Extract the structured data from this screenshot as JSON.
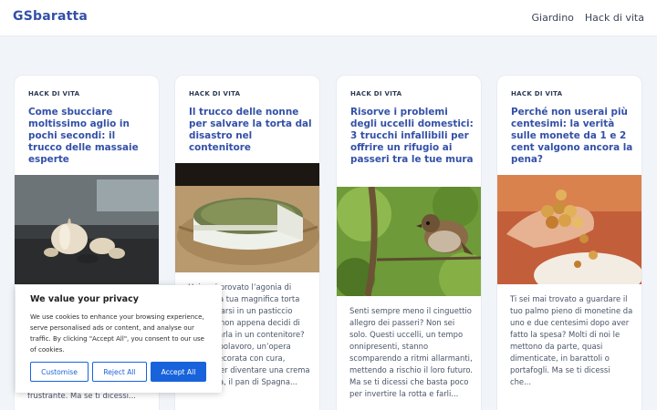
{
  "site": {
    "logo": "GSbaratta"
  },
  "nav": {
    "items": [
      "Giardino",
      "Hack di vita"
    ]
  },
  "cards": [
    {
      "category": "HACK DI VITA",
      "title": "Come sbucciare moltissimo aglio in pochi secondi: il trucco delle massaie esperte",
      "image": "garlic-photo",
      "excerpt": "frustrante. Ma se ti dicessi..."
    },
    {
      "category": "HACK DI VITA",
      "title": "Il trucco delle nonne per salvare la torta dal disastro nel contenitore",
      "image": "cake-photo",
      "excerpt": "Hai mai provato l’agonia di vedere la tua magnifica torta trasformarsi in un pasticcio informe non appena decidi di conservarla in un contenitore? Il tuo capolavoro, un’opera d’arte decorata con cura, finisce per diventare una crema spatolata, il pan di Spagna..."
    },
    {
      "category": "HACK DI VITA",
      "title": "Risorve i problemi degli uccelli domestici: 3 trucchi infallibili per offrire un rifugio ai passeri tra le tue mura",
      "image": "sparrow-photo",
      "excerpt": "Senti sempre meno il cinguettio allegro dei passeri? Non sei solo. Questi uccelli, un tempo onnipresenti, stanno scomparendo a ritmi allarmanti, mettendo a rischio il loro futuro. Ma se ti dicessi che basta poco per invertire la rotta e farli..."
    },
    {
      "category": "HACK DI VITA",
      "title": "Perché non userai più centesimi: la verità sulle monete da 1 e 2 cent valgono ancora la pena?",
      "image": "coins-photo",
      "excerpt": "Ti sei mai trovato a guardare il tuo palmo pieno di monetine da uno e due centesimi dopo aver fatto la spesa? Molti di noi le mettono da parte, quasi dimenticate, in barattoli o portafogli. Ma se ti dicessi che..."
    }
  ],
  "cookie": {
    "title": "We value your privacy",
    "text": "We use cookies to enhance your browsing experience, serve personalised ads or content, and analyse our traffic. By clicking \"Accept All\", you consent to our use of cookies.",
    "customise": "Customise",
    "reject": "Reject All",
    "accept": "Accept All",
    "accent": "#1863dc"
  },
  "colors": {
    "brand": "#3350a8",
    "background": "#f1f5fa"
  }
}
